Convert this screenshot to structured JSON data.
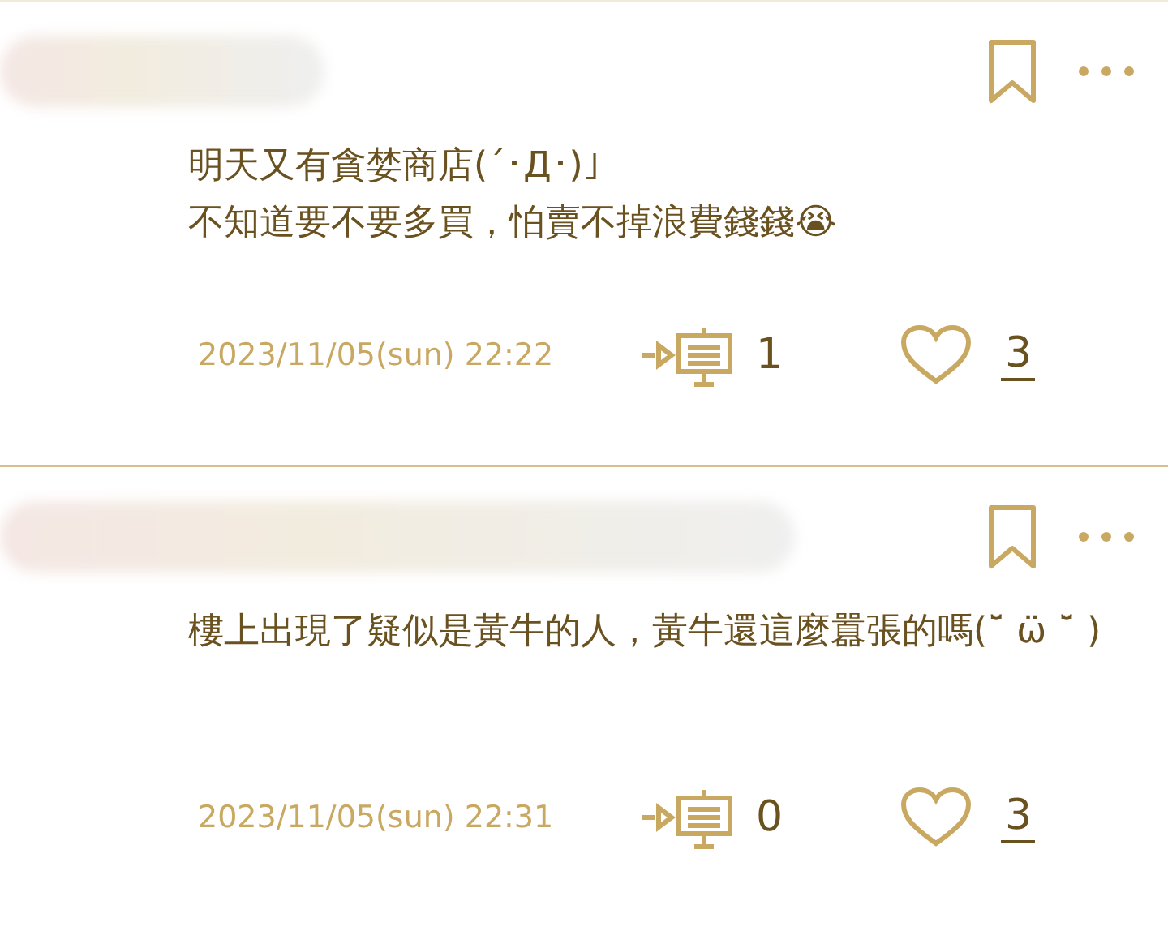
{
  "comments": [
    {
      "lines": [
        "明天又有貪婪商店(´･Д･)」",
        "不知道要不要多買，怕賣不掉浪費錢錢😭"
      ],
      "date": "2023/11/05(sun) 22:22",
      "replies": "1",
      "likes": "3"
    },
    {
      "lines": [
        "樓上出現了疑似是黃牛的人，黃牛還這麼囂張的嗎(˘̈ ω̈ ˘̈ )"
      ],
      "date": "2023/11/05(sun) 22:31",
      "replies": "0",
      "likes": "3"
    }
  ]
}
